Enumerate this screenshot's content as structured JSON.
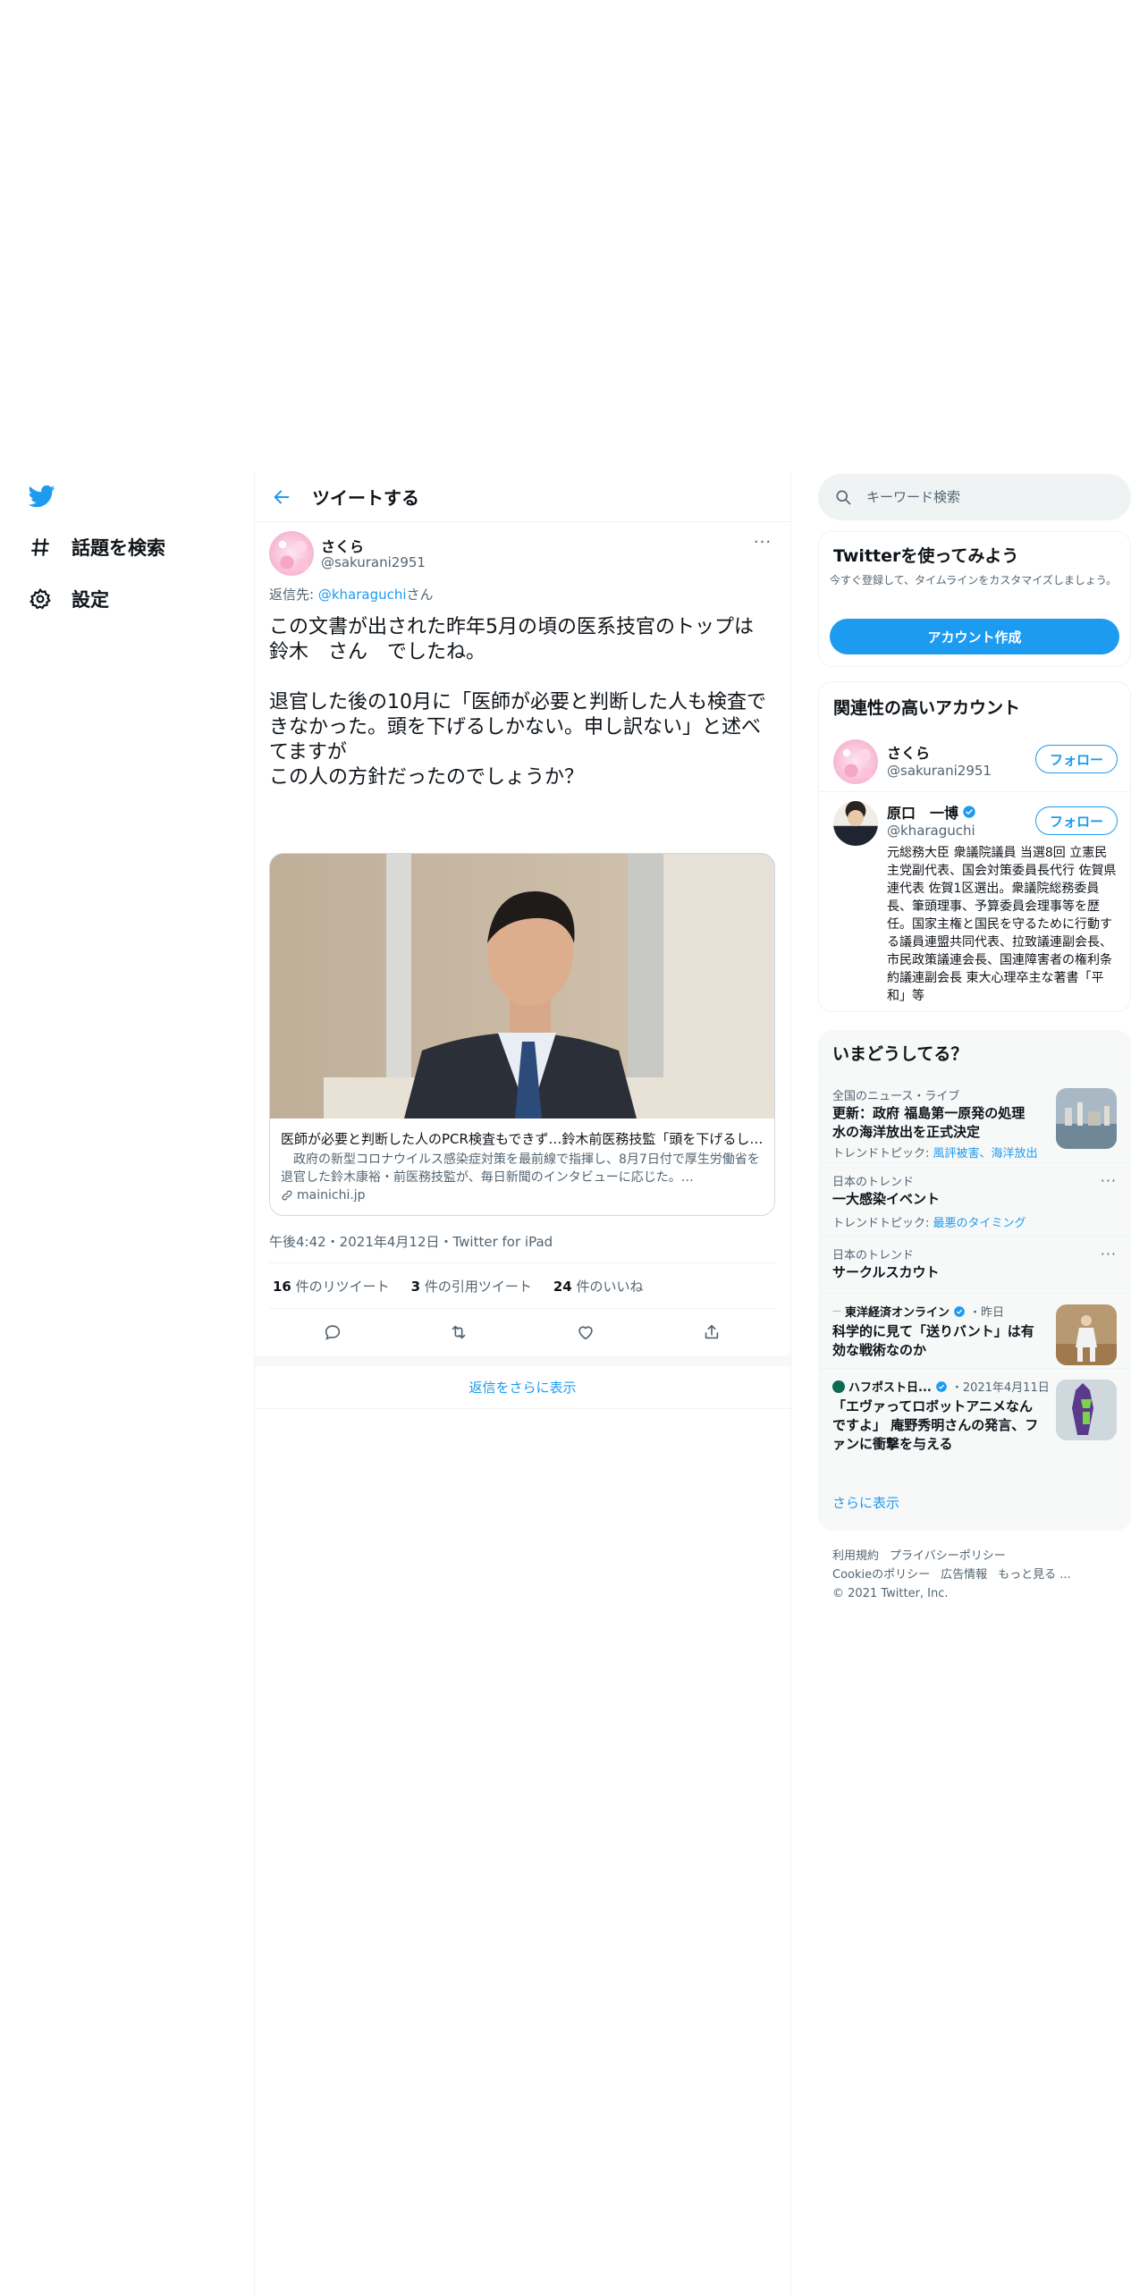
{
  "nav": {
    "items": [
      {
        "label": "話題を検索",
        "icon": "hashtag-icon"
      },
      {
        "label": "設定",
        "icon": "gear-icon"
      }
    ]
  },
  "header": {
    "title": "ツイートする"
  },
  "tweet": {
    "author_name": "さくら",
    "author_handle": "@sakurani2951",
    "more": "···",
    "reply_prefix": "返信先: ",
    "reply_handle": "@kharaguchi",
    "reply_suffix": "さん",
    "text": "この文書が出された昨年5月の頃の医系技官のトップは\n鈴木　さん　でしたね。\n\n退官した後の10月に「医師が必要と判断した人も検査できなかった。頭を下げるしかない。申し訳ない」と述べてますが\nこの人の方針だったのでしょうか？",
    "card": {
      "title": "医師が必要と判断した人のPCR検査もできず…鈴木前医務技監「頭を下げるしかない」",
      "description": "　政府の新型コロナウイルス感染症対策を最前線で指揮し、8月7日付で厚生労働省を退官した鈴木康裕・前医務技監が、毎日新聞のインタビューに応じた。…",
      "domain": "mainichi.jp"
    },
    "meta": "午後4:42・2021年4月12日・Twitter for iPad",
    "stats": {
      "retweets_count": "16",
      "retweets_label": " 件のリツイート",
      "quotes_count": "3",
      "quotes_label": " 件の引用ツイート",
      "likes_count": "24",
      "likes_label": " 件のいいね"
    }
  },
  "show_more_replies": "返信をさらに表示",
  "search": {
    "placeholder": "キーワード検索"
  },
  "signup": {
    "title": "Twitterを使ってみよう",
    "subtitle": "今すぐ登録して、タイムラインをカスタマイズしましょう。",
    "button": "アカウント作成"
  },
  "who_to_follow": {
    "title": "関連性の高いアカウント",
    "follow_label": "フォロー",
    "accounts": [
      {
        "name": "さくら",
        "handle": "@sakurani2951",
        "bio": ""
      },
      {
        "name": "原口　一博",
        "handle": "@kharaguchi",
        "bio": "元総務大臣 衆議院議員 当選8回 立憲民主党副代表、国会対策委員長代行 佐賀県連代表 佐賀1区選出。衆議院総務委員長、筆頭理事、予算委員会理事等を歴任。国家主権と国民を守るために行動する議員連盟共同代表、拉致議連副会長、市民政策議連会長、国連障害者の権利条約議連副会長 東大心理卒主な著書「平和」等"
      }
    ]
  },
  "trends": {
    "title": "いまどうしてる？",
    "items": [
      {
        "meta": "全国のニュース・ライブ",
        "title": "更新：政府 福島第一原発の処理水の海洋放出を正式決定",
        "topic_prefix": "トレンドトピック: ",
        "topic": "風評被害、海洋放出"
      },
      {
        "meta": "日本のトレンド",
        "title": "一大感染イベント",
        "topic_prefix": "トレンドトピック: ",
        "topic": "最悪のタイミング"
      },
      {
        "meta": "日本のトレンド",
        "title": "サークルスカウト"
      },
      {
        "source": "東洋経済オンライン",
        "date": "・昨日",
        "title": "科学的に見て「送りバント」は有効な戦術なのか"
      },
      {
        "source": "ハフポスト日...",
        "date": "・2021年4月11日",
        "title": "「エヴァってロボットアニメなんですよ」 庵野秀明さんの発言、ファンに衝撃を与える"
      }
    ],
    "show_more": "さらに表示"
  },
  "footer": {
    "links": [
      "利用規約",
      "プライバシーポリシー",
      "Cookieのポリシー",
      "広告情報",
      "もっと見る ..."
    ],
    "copyright": "© 2021 Twitter, Inc."
  },
  "colors": {
    "accent": "#1d9bf0",
    "text": "#0f1419",
    "secondary": "#536471"
  }
}
